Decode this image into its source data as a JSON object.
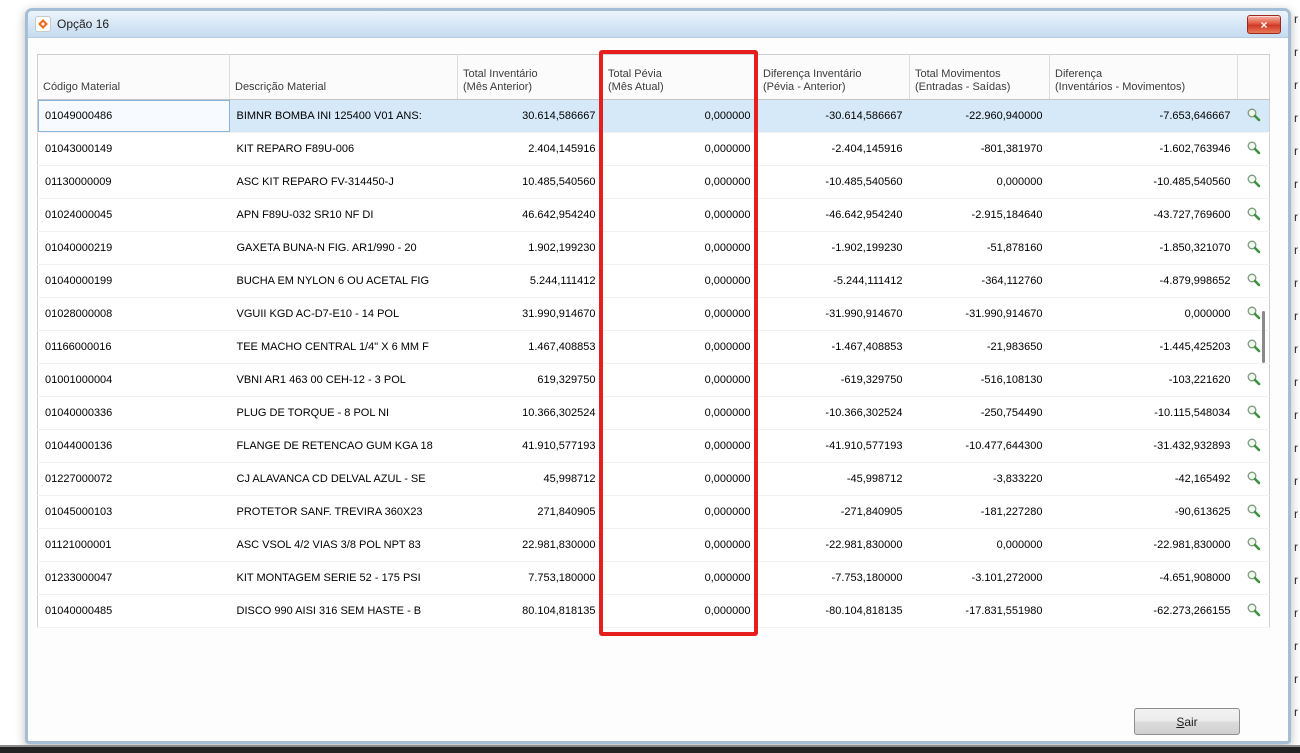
{
  "window": {
    "title": "Opção 16",
    "close_glyph": "×"
  },
  "icons": {
    "titlebar": "app-logo",
    "close": "close-x",
    "row_action": "magnifier"
  },
  "table": {
    "columns": [
      {
        "key": "codigo",
        "line1": "Código Material",
        "line2": ""
      },
      {
        "key": "descricao",
        "line1": "Descrição Material",
        "line2": ""
      },
      {
        "key": "total_inventario",
        "line1": "Total Inventário",
        "line2": "(Mês Anterior)"
      },
      {
        "key": "total_pevia",
        "line1": "Total Pévia",
        "line2": "(Mês Atual)"
      },
      {
        "key": "dif_inventario",
        "line1": "Diferença Inventário",
        "line2": "(Pévia - Anterior)"
      },
      {
        "key": "total_movimentos",
        "line1": "Total Movimentos",
        "line2": "(Entradas - Saídas)"
      },
      {
        "key": "diferenca",
        "line1": "Diferença",
        "line2": "(Inventários - Movimentos)"
      },
      {
        "key": "actions",
        "line1": "",
        "line2": ""
      }
    ],
    "rows": [
      {
        "selected": true,
        "codigo": "01049000486",
        "descricao": "BIMNR BOMBA INI 125400 V01 ANS:",
        "total_inventario": "30.614,586667",
        "total_pevia": "0,000000",
        "dif_inventario": "-30.614,586667",
        "total_movimentos": "-22.960,940000",
        "diferenca": "-7.653,646667"
      },
      {
        "selected": false,
        "codigo": "01043000149",
        "descricao": "KIT REPARO F89U-006",
        "total_inventario": "2.404,145916",
        "total_pevia": "0,000000",
        "dif_inventario": "-2.404,145916",
        "total_movimentos": "-801,381970",
        "diferenca": "-1.602,763946"
      },
      {
        "selected": false,
        "codigo": "01130000009",
        "descricao": "ASC KIT REPARO FV-314450-J",
        "total_inventario": "10.485,540560",
        "total_pevia": "0,000000",
        "dif_inventario": "-10.485,540560",
        "total_movimentos": "0,000000",
        "diferenca": "-10.485,540560"
      },
      {
        "selected": false,
        "codigo": "01024000045",
        "descricao": "APN F89U-032 SR10 NF DI",
        "total_inventario": "46.642,954240",
        "total_pevia": "0,000000",
        "dif_inventario": "-46.642,954240",
        "total_movimentos": "-2.915,184640",
        "diferenca": "-43.727,769600"
      },
      {
        "selected": false,
        "codigo": "01040000219",
        "descricao": "GAXETA BUNA-N FIG. AR1/990 - 20",
        "total_inventario": "1.902,199230",
        "total_pevia": "0,000000",
        "dif_inventario": "-1.902,199230",
        "total_movimentos": "-51,878160",
        "diferenca": "-1.850,321070"
      },
      {
        "selected": false,
        "codigo": "01040000199",
        "descricao": "BUCHA EM NYLON 6 OU ACETAL FIG",
        "total_inventario": "5.244,111412",
        "total_pevia": "0,000000",
        "dif_inventario": "-5.244,111412",
        "total_movimentos": "-364,112760",
        "diferenca": "-4.879,998652"
      },
      {
        "selected": false,
        "codigo": "01028000008",
        "descricao": "VGUII KGD AC-D7-E10 - 14 POL",
        "total_inventario": "31.990,914670",
        "total_pevia": "0,000000",
        "dif_inventario": "-31.990,914670",
        "total_movimentos": "-31.990,914670",
        "diferenca": "0,000000"
      },
      {
        "selected": false,
        "codigo": "01166000016",
        "descricao": "TEE MACHO CENTRAL 1/4\" X 6 MM F",
        "total_inventario": "1.467,408853",
        "total_pevia": "0,000000",
        "dif_inventario": "-1.467,408853",
        "total_movimentos": "-21,983650",
        "diferenca": "-1.445,425203"
      },
      {
        "selected": false,
        "codigo": "01001000004",
        "descricao": "VBNI AR1 463 00 CEH-12 - 3 POL",
        "total_inventario": "619,329750",
        "total_pevia": "0,000000",
        "dif_inventario": "-619,329750",
        "total_movimentos": "-516,108130",
        "diferenca": "-103,221620"
      },
      {
        "selected": false,
        "codigo": "01040000336",
        "descricao": "PLUG DE TORQUE - 8 POL NI",
        "total_inventario": "10.366,302524",
        "total_pevia": "0,000000",
        "dif_inventario": "-10.366,302524",
        "total_movimentos": "-250,754490",
        "diferenca": "-10.115,548034"
      },
      {
        "selected": false,
        "codigo": "01044000136",
        "descricao": "FLANGE DE RETENCAO GUM KGA 18",
        "total_inventario": "41.910,577193",
        "total_pevia": "0,000000",
        "dif_inventario": "-41.910,577193",
        "total_movimentos": "-10.477,644300",
        "diferenca": "-31.432,932893"
      },
      {
        "selected": false,
        "codigo": "01227000072",
        "descricao": "CJ ALAVANCA CD DELVAL AZUL - SE",
        "total_inventario": "45,998712",
        "total_pevia": "0,000000",
        "dif_inventario": "-45,998712",
        "total_movimentos": "-3,833220",
        "diferenca": "-42,165492"
      },
      {
        "selected": false,
        "codigo": "01045000103",
        "descricao": "PROTETOR SANF. TREVIRA 360X23",
        "total_inventario": "271,840905",
        "total_pevia": "0,000000",
        "dif_inventario": "-271,840905",
        "total_movimentos": "-181,227280",
        "diferenca": "-90,613625"
      },
      {
        "selected": false,
        "codigo": "01121000001",
        "descricao": "ASC VSOL 4/2 VIAS 3/8 POL NPT 83",
        "total_inventario": "22.981,830000",
        "total_pevia": "0,000000",
        "dif_inventario": "-22.981,830000",
        "total_movimentos": "0,000000",
        "diferenca": "-22.981,830000"
      },
      {
        "selected": false,
        "codigo": "01233000047",
        "descricao": "KIT MONTAGEM SERIE 52 - 175 PSI",
        "total_inventario": "7.753,180000",
        "total_pevia": "0,000000",
        "dif_inventario": "-7.753,180000",
        "total_movimentos": "-3.101,272000",
        "diferenca": "-4.651,908000"
      },
      {
        "selected": false,
        "codigo": "01040000485",
        "descricao": "DISCO 990 AISI 316 SEM HASTE - B",
        "total_inventario": "80.104,818135",
        "total_pevia": "0,000000",
        "dif_inventario": "-80.104,818135",
        "total_movimentos": "-17.831,551980",
        "diferenca": "-62.273,266155"
      }
    ]
  },
  "footer": {
    "sair_label": "Sair"
  },
  "edge_marks": {
    "glyph": "r",
    "count": 22
  },
  "colors": {
    "annotation_red": "#e61e1e",
    "negative_dark": "#8e3039",
    "negative_bright": "#e02a1f",
    "selection_blue": "#d6e9f8",
    "titlebar_blue": "#d3e5f5",
    "titlebar_blue_light": "#ecf4fb",
    "window_border": "#a3bed5"
  }
}
